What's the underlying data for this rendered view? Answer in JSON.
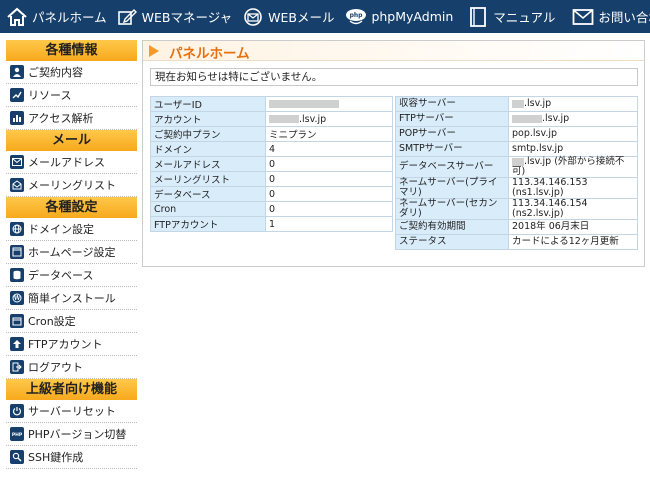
{
  "topnav": {
    "items": [
      {
        "label": "パネルホーム",
        "icon": "home-icon"
      },
      {
        "label": "WEBマネージャ",
        "icon": "edit-icon"
      },
      {
        "label": "WEBメール",
        "icon": "web-mail-icon"
      },
      {
        "label": "phpMyAdmin",
        "icon": "php-icon"
      },
      {
        "label": "マニュアル",
        "icon": "book-icon"
      },
      {
        "label": "お問い合わせ",
        "icon": "mail-icon"
      }
    ]
  },
  "sidebar": {
    "sections": [
      {
        "title": "各種情報",
        "items": [
          {
            "label": "ご契約内容",
            "icon": "user-icon"
          },
          {
            "label": "リソース",
            "icon": "line-chart-icon"
          },
          {
            "label": "アクセス解析",
            "icon": "bar-chart-icon"
          }
        ]
      },
      {
        "title": "メール",
        "items": [
          {
            "label": "メールアドレス",
            "icon": "envelope-icon"
          },
          {
            "label": "メーリングリスト",
            "icon": "mailing-list-icon"
          }
        ]
      },
      {
        "title": "各種設定",
        "items": [
          {
            "label": "ドメイン設定",
            "icon": "globe-icon"
          },
          {
            "label": "ホームページ設定",
            "icon": "webpage-icon"
          },
          {
            "label": "データベース",
            "icon": "database-icon"
          },
          {
            "label": "簡単インストール",
            "icon": "wordpress-icon"
          },
          {
            "label": "Cron設定",
            "icon": "calendar-icon"
          },
          {
            "label": "FTPアカウント",
            "icon": "ftp-icon"
          },
          {
            "label": "ログアウト",
            "icon": "logout-icon"
          }
        ]
      },
      {
        "title": "上級者向け機能",
        "items": [
          {
            "label": "サーバーリセット",
            "icon": "power-icon"
          },
          {
            "label": "PHPバージョン切替",
            "icon": "php-badge-icon"
          },
          {
            "label": "SSH鍵作成",
            "icon": "key-search-icon"
          }
        ]
      }
    ]
  },
  "main": {
    "title": "パネルホーム",
    "notice": "現在お知らせは特にございません。",
    "left_table": [
      {
        "key": "ユーザーID",
        "value": ""
      },
      {
        "key": "アカウント",
        "value": ".lsv.jp"
      },
      {
        "key": "ご契約中プラン",
        "value": "ミニプラン"
      },
      {
        "key": "ドメイン",
        "value": "4"
      },
      {
        "key": "メールアドレス",
        "value": "0"
      },
      {
        "key": "メーリングリスト",
        "value": "0"
      },
      {
        "key": "データベース",
        "value": "0"
      },
      {
        "key": "Cron",
        "value": "0"
      },
      {
        "key": "FTPアカウント",
        "value": "1"
      }
    ],
    "right_table": [
      {
        "key": "収容サーバー",
        "value": ".lsv.jp"
      },
      {
        "key": "FTPサーバー",
        "value": ".lsv.jp"
      },
      {
        "key": "POPサーバー",
        "value": "pop.lsv.jp"
      },
      {
        "key": "SMTPサーバー",
        "value": "smtp.lsv.jp"
      },
      {
        "key": "データベースサーバー",
        "value": ".lsv.jp (外部から接続不可)"
      },
      {
        "key": "ネームサーバー(プライマリ)",
        "value": "113.34.146.153 (ns1.lsv.jp)"
      },
      {
        "key": "ネームサーバー(セカンダリ)",
        "value": "113.34.146.154 (ns2.lsv.jp)"
      },
      {
        "key": "ご契約有効期間",
        "value": "2018年 06月末日"
      },
      {
        "key": "ステータス",
        "value": "カードによる12ヶ月更新"
      }
    ]
  },
  "colors": {
    "nav_bg": "#163f6b",
    "section_head": "#f7a91c",
    "title_accent": "#e86f0c",
    "table_key_bg": "#d9ecfa"
  }
}
